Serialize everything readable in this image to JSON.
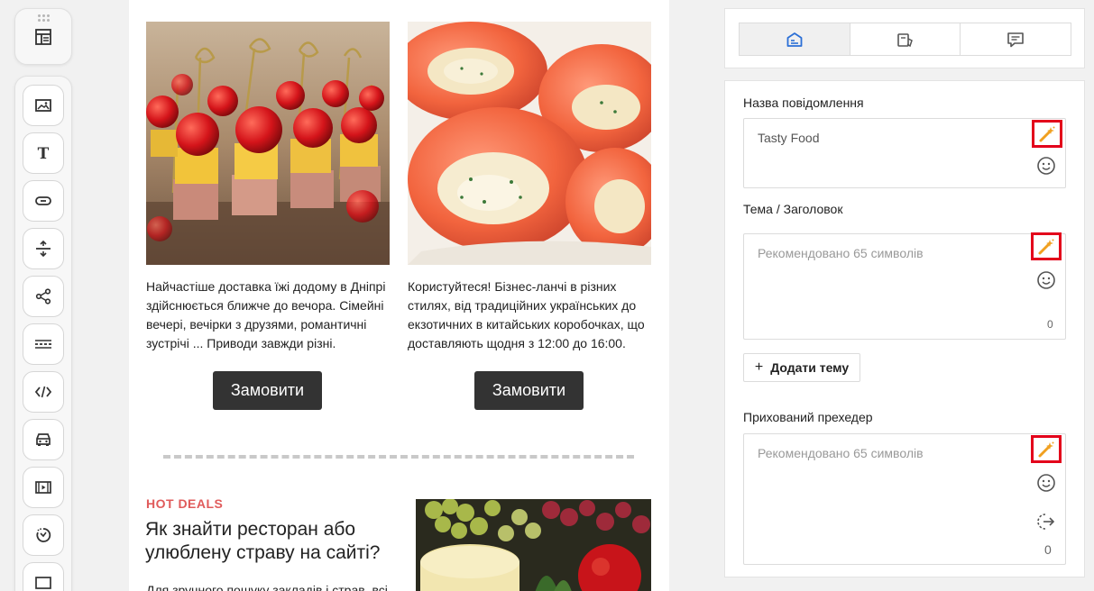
{
  "colors": {
    "accent_red": "#e3001b",
    "hot_deals": "#e05b5b",
    "button_dark": "#333333",
    "tab_active_icon": "#2b6fd6"
  },
  "toolbar": {
    "top_icon": "template-layout-icon",
    "tools": [
      {
        "name": "image-block-icon"
      },
      {
        "name": "text-block-icon"
      },
      {
        "name": "button-block-icon"
      },
      {
        "name": "spacer-block-icon"
      },
      {
        "name": "social-share-icon"
      },
      {
        "name": "divider-block-icon"
      },
      {
        "name": "html-code-icon"
      },
      {
        "name": "product-block-icon"
      },
      {
        "name": "video-block-icon"
      },
      {
        "name": "timer-block-icon"
      },
      {
        "name": "more-block-icon"
      }
    ]
  },
  "email": {
    "card_left": {
      "text": "Найчастіше доставка їжі додому в Дніпрі здійснюється ближче до вечора. Сімейні вечері, вечірки з друзями, романтичні зустрічі ... Приводи завжди різні.",
      "button": "Замовити"
    },
    "card_right": {
      "text": "Користуйтеся! Бізнес-ланчі в різних стилях, від традиційних українських до екзотичних в китайських коробочках, що доставляють щодня з 12:00 до 16:00.",
      "button": "Замовити"
    },
    "hot_deals": {
      "label": "HOT DEALS",
      "title": "Як знайти ресторан або улюблену страву на сайті?",
      "body": "Для зручного пошуку закладів і страв, всі"
    }
  },
  "settings": {
    "tabs": [
      {
        "icon": "email-settings-icon",
        "active": true
      },
      {
        "icon": "sms-settings-icon",
        "active": false
      },
      {
        "icon": "message-settings-icon",
        "active": false
      }
    ],
    "message_name": {
      "label": "Назва повідомлення",
      "value": "Tasty Food"
    },
    "subject": {
      "label": "Тема / Заголовок",
      "placeholder": "Рекомендовано 65 символів",
      "count": "0"
    },
    "add_topic": {
      "plus": "+",
      "label": "Додати тему"
    },
    "preheader": {
      "label": "Прихований прехедер",
      "placeholder": "Рекомендовано 65 символів",
      "count": "0"
    }
  }
}
